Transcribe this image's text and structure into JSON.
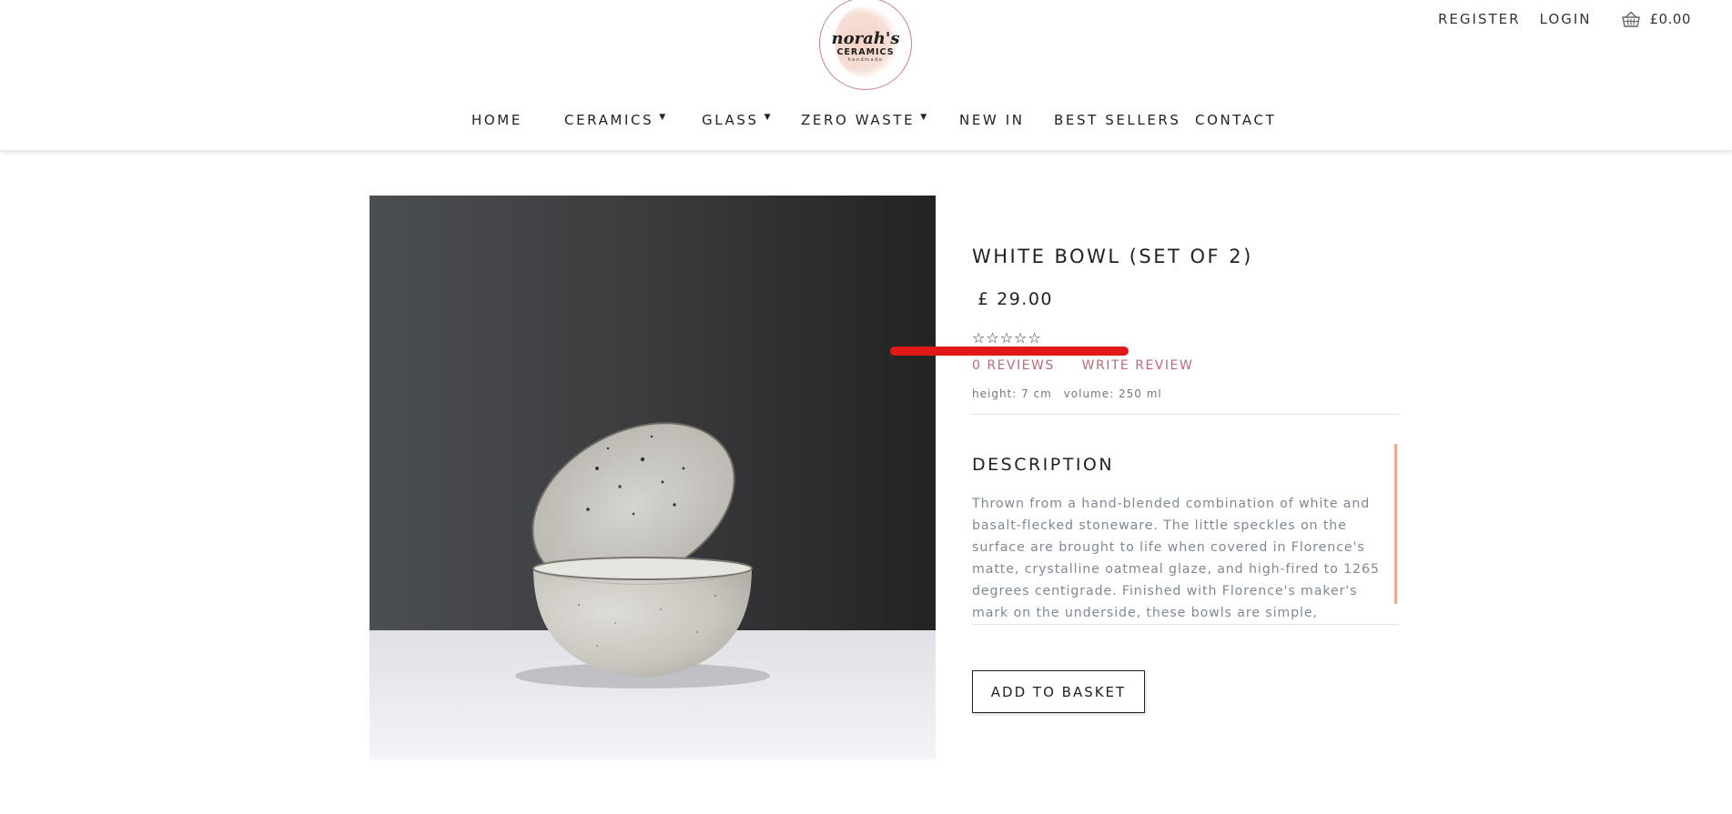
{
  "brand": {
    "name": "norah's",
    "line2": "CERAMICS",
    "line3": "handmade",
    "colors": {
      "ring": "#c9828d",
      "blob": "#f3d2c6"
    }
  },
  "account": {
    "register": "REGISTER",
    "login": "LOGIN",
    "cart_total": "£0.00",
    "cart_icon": "basket-icon"
  },
  "nav": {
    "items": [
      {
        "label": "HOME",
        "has_dropdown": false
      },
      {
        "label": "CERAMICS",
        "has_dropdown": true
      },
      {
        "label": "GLASS",
        "has_dropdown": true
      },
      {
        "label": "ZERO WASTE",
        "has_dropdown": true
      },
      {
        "label": "NEW IN",
        "has_dropdown": false
      },
      {
        "label": "BEST SELLERS",
        "has_dropdown": false
      },
      {
        "label": "CONTACT",
        "has_dropdown": false
      }
    ],
    "caret": "▼"
  },
  "product": {
    "title": "WHITE BOWL (SET OF 2)",
    "price": "£ 29.00",
    "stars": "☆☆☆☆☆",
    "rating": 0,
    "reviews_label": "0 REVIEWS",
    "write_review_label": "WRITE REVIEW",
    "height": "height: 7 cm",
    "volume": "volume: 250 ml",
    "description_heading": "DESCRIPTION",
    "description": "Thrown from a hand-blended combination of white and basalt-flecked stoneware. The little speckles on the surface are brought to life when covered in Florence's matte, crystalline oatmeal glaze, and high-fired to 1265 degrees centigrade. Finished with Florence's maker's mark on the underside, these bowls are simple,",
    "add_to_basket": "ADD TO BASKET",
    "colors": {
      "review_link": "#b86b78",
      "description_text": "#7e8894",
      "scrollbar": "#f0a58f",
      "annotation_mark": "#e01818"
    }
  }
}
